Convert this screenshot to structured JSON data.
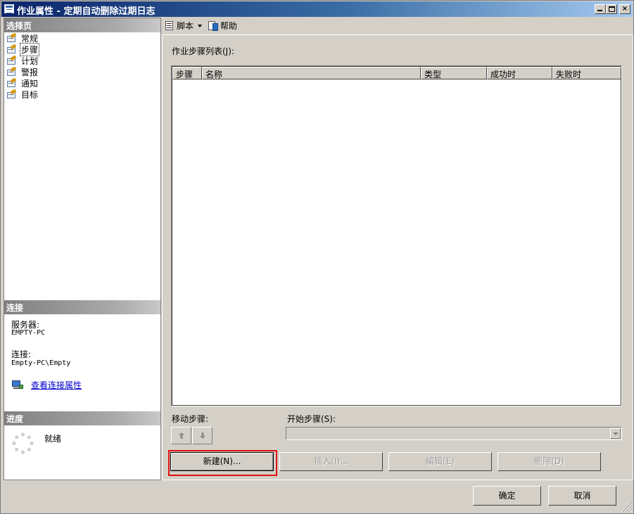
{
  "window": {
    "title": "作业属性 - 定期自动删除过期日志",
    "controls": {
      "minimize": "_",
      "maximize": "□",
      "close": "×"
    }
  },
  "left": {
    "pages_header": "选择页",
    "pages": [
      {
        "label": "常规",
        "icon": "page-icon",
        "selected": false
      },
      {
        "label": "步骤",
        "icon": "page-icon",
        "selected": true
      },
      {
        "label": "计划",
        "icon": "page-icon",
        "selected": false
      },
      {
        "label": "警报",
        "icon": "page-icon",
        "selected": false
      },
      {
        "label": "通知",
        "icon": "page-icon",
        "selected": false
      },
      {
        "label": "目标",
        "icon": "page-icon",
        "selected": false
      }
    ],
    "connection_header": "连接",
    "server_label": "服务器:",
    "server_value": "EMPTY-PC",
    "connection_label": "连接:",
    "connection_value": "Empty-PC\\Empty",
    "view_connection_link": "查看连接属性",
    "progress_header": "进度",
    "status": "就绪"
  },
  "toolbar": {
    "script_label": "脚本",
    "help_label": "帮助"
  },
  "main": {
    "list_title": "作业步骤列表(J):",
    "columns": [
      "步骤",
      "名称",
      "类型",
      "成功时",
      "失败时"
    ],
    "rows": [],
    "move_steps_label": "移动步骤:",
    "start_step_label": "开始步骤(S):",
    "start_step_value": "",
    "buttons": {
      "new": "新建(N)...",
      "insert": "插入(I)...",
      "edit": "编辑(E)",
      "delete": "删除(D)"
    }
  },
  "footer": {
    "ok": "确定",
    "cancel": "取消"
  },
  "colors": {
    "titlebar_start": "#0a246a",
    "titlebar_end": "#a6caf0",
    "face": "#d4d0c8",
    "highlight_outline": "#e01010",
    "link": "#0000cc"
  }
}
